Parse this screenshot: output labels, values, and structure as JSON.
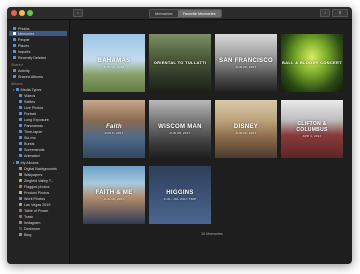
{
  "titlebar": {
    "tabs": [
      {
        "label": "Memories",
        "active": false
      },
      {
        "label": "Favorite Memories",
        "active": true
      }
    ]
  },
  "sidebar": {
    "top_items": [
      {
        "label": "Photos",
        "selected": false
      },
      {
        "label": "Memories",
        "selected": true
      },
      {
        "label": "People",
        "selected": false
      },
      {
        "label": "Places",
        "selected": false
      },
      {
        "label": "Imports",
        "selected": false
      },
      {
        "label": "Recently Deleted",
        "selected": false
      }
    ],
    "shared_header": "Shared",
    "shared_items": [
      {
        "label": "Activity"
      },
      {
        "label": "Shared Albums"
      }
    ],
    "albums_header": "Albums",
    "media_types": {
      "label": "Media Types",
      "items": [
        "Videos",
        "Selfies",
        "Live Photos",
        "Portrait",
        "Long Exposure",
        "Panoramas",
        "Time-lapse",
        "Slo-mo",
        "Bursts",
        "Screenshots",
        "Animated"
      ]
    },
    "my_albums": {
      "label": "My Albums",
      "items": [
        "Digital Backgrounds",
        "Wallpapers",
        "Ziegfeld Valley T...",
        "Flagged photos",
        "Product Photos",
        "Work Photos",
        "Las Vegas 2019",
        "Table of Power",
        "Trash",
        "Instagram",
        "Darkroom",
        "Blog"
      ]
    }
  },
  "memories": [
    {
      "title": "BAHAMAS",
      "subtitle": "JUN 16, 2018"
    },
    {
      "title": "ORIENTAL TO TULLATTI",
      "subtitle": ""
    },
    {
      "title": "SAN FRANCISCO",
      "subtitle": "JUN 20, 2017"
    },
    {
      "title": "BALL & BLOODY CONCERT",
      "subtitle": ""
    },
    {
      "title": "Faith",
      "subtitle": "JUN 5, 2017"
    },
    {
      "title": "WISCOM MAN",
      "subtitle": "JUN 28, 2017"
    },
    {
      "title": "DISNEY",
      "subtitle": "JUN 26, 2017"
    },
    {
      "title": "CLIFTON & COLUMBUS",
      "subtitle": "APR 1, 2017"
    },
    {
      "title": "FAITH & ME",
      "subtitle": "JUN 18, 2017"
    },
    {
      "title": "HIGGINS",
      "subtitle": "JUN - JUL 2017 TRIP"
    }
  ],
  "footer": {
    "count": "10 Memories"
  },
  "colors": {
    "window_bg": "#1e1e1e",
    "sidebar_bg": "#232323",
    "selection": "#3d5a86",
    "icon_accent": "#5b8fd8"
  }
}
